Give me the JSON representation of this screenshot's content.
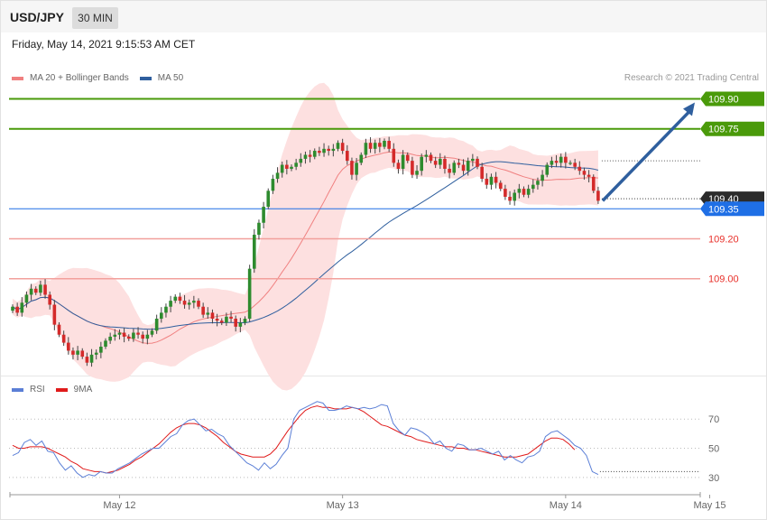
{
  "header": {
    "symbol": "USD/JPY",
    "timeframe": "30 MIN",
    "datetime": "Friday, May 14, 2021 9:15:53 AM CET"
  },
  "legend": {
    "items": [
      {
        "label": "MA 20 + Bollinger Bands",
        "color": "#f08080"
      },
      {
        "label": "MA 50",
        "color": "#2f5f9e"
      }
    ],
    "credit": "Research © 2021 Trading Central"
  },
  "rsi_legend": {
    "items": [
      {
        "label": "RSI",
        "color": "#5b7fd6"
      },
      {
        "label": "9MA",
        "color": "#e01b1b"
      }
    ]
  },
  "chart_data": [
    {
      "type": "candlestick",
      "title": "",
      "price_range": [
        108.52,
        109.97
      ],
      "x_ticks": [
        {
          "label": "May 12",
          "index": 23
        },
        {
          "label": "May 13",
          "index": 71
        },
        {
          "label": "May 14",
          "index": 119
        },
        {
          "label": "May 15",
          "index": 150
        }
      ],
      "levels": [
        {
          "label": "109.90",
          "value": 109.9,
          "color": "#4a9a0a",
          "style": "resistance"
        },
        {
          "label": "109.75",
          "value": 109.75,
          "color": "#4a9a0a",
          "style": "resistance"
        },
        {
          "label": "109.40",
          "value": 109.4,
          "color": "#333333",
          "style": "current"
        },
        {
          "label": "109.35",
          "value": 109.35,
          "color": "#1f6fe5",
          "style": "pivot"
        },
        {
          "label": "109.20",
          "value": 109.2,
          "color": "#e8302a",
          "style": "support"
        },
        {
          "label": "109.00",
          "value": 109.0,
          "color": "#e8302a",
          "style": "support"
        }
      ],
      "target_arrow": {
        "from": 109.39,
        "to": 109.9
      },
      "closes": [
        108.86,
        108.83,
        108.88,
        108.92,
        108.95,
        108.93,
        108.97,
        108.92,
        108.87,
        108.77,
        108.72,
        108.68,
        108.64,
        108.62,
        108.64,
        108.61,
        108.58,
        108.62,
        108.63,
        108.66,
        108.69,
        108.71,
        108.72,
        108.73,
        108.71,
        108.7,
        108.73,
        108.72,
        108.7,
        108.72,
        108.74,
        108.8,
        108.83,
        108.86,
        108.89,
        108.91,
        108.89,
        108.87,
        108.88,
        108.89,
        108.86,
        108.82,
        108.83,
        108.8,
        108.79,
        108.78,
        108.81,
        108.8,
        108.76,
        108.78,
        108.8,
        109.05,
        109.22,
        109.28,
        109.36,
        109.44,
        109.5,
        109.53,
        109.57,
        109.55,
        109.56,
        109.58,
        109.6,
        109.62,
        109.61,
        109.64,
        109.63,
        109.65,
        109.64,
        109.65,
        109.68,
        109.64,
        109.59,
        109.52,
        109.58,
        109.62,
        109.68,
        109.65,
        109.68,
        109.66,
        109.69,
        109.65,
        109.58,
        109.55,
        109.62,
        109.59,
        109.52,
        109.54,
        109.61,
        109.62,
        109.59,
        109.57,
        109.6,
        109.55,
        109.53,
        109.58,
        109.57,
        109.54,
        109.59,
        109.6,
        109.56,
        109.5,
        109.47,
        109.51,
        109.48,
        109.45,
        109.41,
        109.39,
        109.43,
        109.45,
        109.42,
        109.45,
        109.47,
        109.49,
        109.52,
        109.57,
        109.59,
        109.58,
        109.61,
        109.58,
        109.58,
        109.56,
        109.54,
        109.52,
        109.51,
        109.44,
        109.39
      ],
      "rsi": {
        "y_ticks": [
          70,
          50,
          30
        ],
        "range": [
          20,
          85
        ],
        "rsi": [
          45,
          47,
          54,
          56,
          52,
          55,
          48,
          47,
          40,
          35,
          38,
          33,
          30,
          32,
          31,
          34,
          33,
          33,
          36,
          38,
          40,
          43,
          46,
          48,
          50,
          50,
          54,
          58,
          60,
          66,
          69,
          70,
          66,
          62,
          63,
          60,
          58,
          52,
          48,
          44,
          40,
          38,
          35,
          40,
          36,
          39,
          45,
          50,
          70,
          76,
          78,
          80,
          82,
          81,
          76,
          76,
          77,
          79,
          78,
          77,
          78,
          77,
          78,
          80,
          79,
          67,
          62,
          59,
          64,
          63,
          61,
          58,
          53,
          55,
          50,
          48,
          53,
          52,
          49,
          49,
          50,
          48,
          46,
          48,
          42,
          45,
          42,
          40,
          44,
          45,
          48,
          58,
          61,
          62,
          59,
          56,
          52,
          50,
          45,
          34,
          32
        ],
        "ma": [
          52,
          50,
          50,
          51,
          51,
          51,
          50,
          48,
          46,
          44,
          41,
          39,
          36,
          35,
          34,
          34,
          33,
          34,
          35,
          37,
          39,
          42,
          44,
          47,
          50,
          53,
          57,
          61,
          64,
          66,
          67,
          67,
          66,
          64,
          61,
          58,
          54,
          51,
          48,
          46,
          45,
          44,
          44,
          44,
          46,
          50,
          56,
          62,
          67,
          72,
          76,
          78,
          79,
          78,
          78,
          77,
          77,
          77,
          78,
          77,
          75,
          72,
          69,
          66,
          65,
          63,
          61,
          59,
          58,
          56,
          55,
          54,
          53,
          52,
          51,
          51,
          50,
          50,
          49,
          49,
          48,
          47,
          46,
          45,
          44,
          44,
          44,
          45,
          46,
          49,
          52,
          55,
          57,
          57,
          56,
          53,
          49
        ]
      }
    }
  ]
}
